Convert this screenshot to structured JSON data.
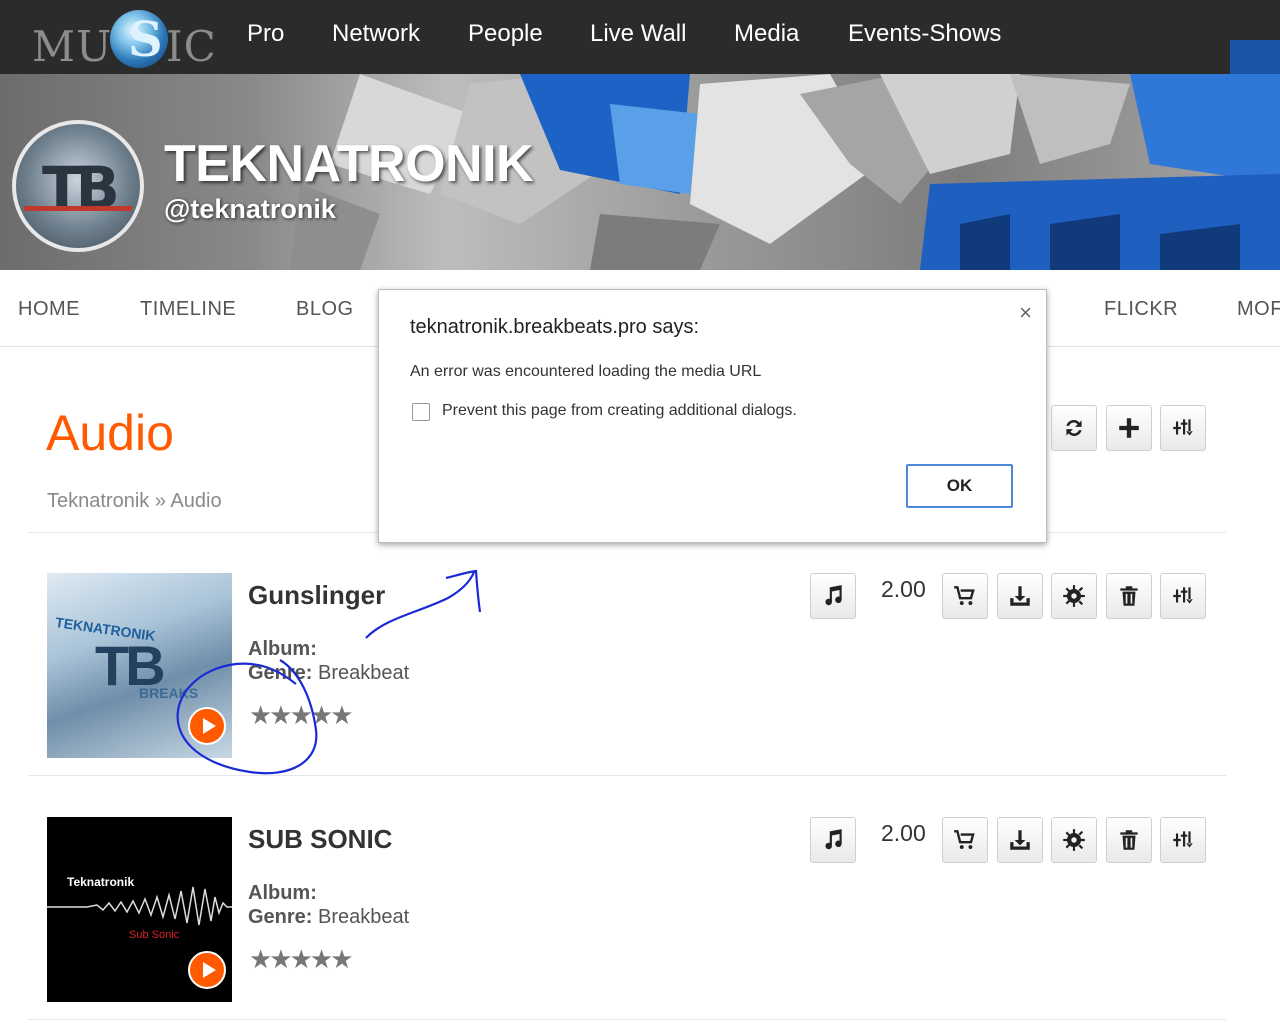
{
  "topnav": {
    "logo": {
      "left": "MU",
      "right": "IC",
      "swoosh": "S"
    },
    "items": [
      "Pro",
      "Network",
      "People",
      "Live Wall",
      "Media",
      "Events-Shows"
    ]
  },
  "profile": {
    "name": "TEKNATRONIK",
    "handle": "@teknatronik"
  },
  "profile_menu": [
    "HOME",
    "TIMELINE",
    "BLOG",
    "FLICKR",
    "MOF"
  ],
  "page": {
    "title": "Audio",
    "breadcrumb": "Teknatronik » Audio"
  },
  "tracks": [
    {
      "title": "Gunslinger",
      "album_label": "Album:",
      "genre_label": "Genre:",
      "genre": "Breakbeat",
      "price": "2.00",
      "stars": "★★★★★",
      "art_text": "TEKNATRONIK",
      "art_sub": "BREAKS",
      "art_mark": "TB"
    },
    {
      "title": "SUB SONIC",
      "album_label": "Album:",
      "genre_label": "Genre:",
      "genre": "Breakbeat",
      "price": "2.00",
      "stars": "★★★★★",
      "art_text": "Teknatronik",
      "art_sub": "Sub Sonic"
    }
  ],
  "avatar": {
    "mark": "TB"
  },
  "dialog": {
    "title": "teknatronik.breakbeats.pro says:",
    "close": "×",
    "message": "An error was encountered loading the media URL",
    "checkbox_label": "Prevent this page from creating additional dialogs.",
    "ok": "OK"
  },
  "colors": {
    "accent": "#ff5a00",
    "topnav": "#2b2b2b",
    "annotation": "#1a2bd6"
  }
}
